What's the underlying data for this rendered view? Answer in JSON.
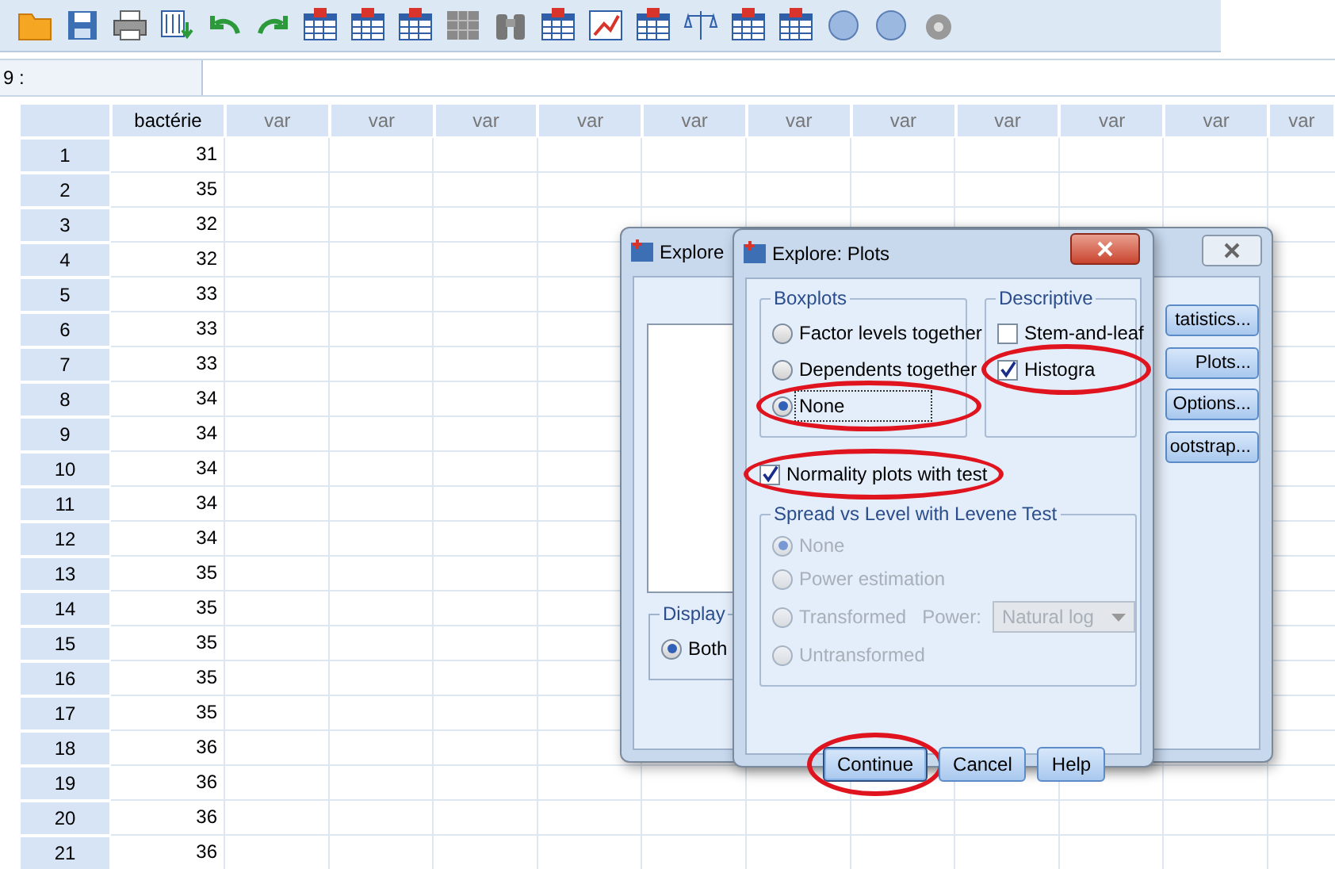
{
  "cell_reference": {
    "label": "9 :"
  },
  "grid": {
    "columns": [
      "bactérie",
      "var",
      "var",
      "var",
      "var",
      "var",
      "var",
      "var",
      "var",
      "var",
      "var",
      "var"
    ],
    "rows": [
      {
        "number": "1",
        "value": "31"
      },
      {
        "number": "2",
        "value": "35"
      },
      {
        "number": "3",
        "value": "32"
      },
      {
        "number": "4",
        "value": "32"
      },
      {
        "number": "5",
        "value": "33"
      },
      {
        "number": "6",
        "value": "33"
      },
      {
        "number": "7",
        "value": "33"
      },
      {
        "number": "8",
        "value": "34"
      },
      {
        "number": "9",
        "value": "34"
      },
      {
        "number": "10",
        "value": "34"
      },
      {
        "number": "11",
        "value": "34"
      },
      {
        "number": "12",
        "value": "34"
      },
      {
        "number": "13",
        "value": "35"
      },
      {
        "number": "14",
        "value": "35"
      },
      {
        "number": "15",
        "value": "35"
      },
      {
        "number": "16",
        "value": "35"
      },
      {
        "number": "17",
        "value": "35"
      },
      {
        "number": "18",
        "value": "36"
      },
      {
        "number": "19",
        "value": "36"
      },
      {
        "number": "20",
        "value": "36"
      },
      {
        "number": "21",
        "value": "36"
      }
    ]
  },
  "explore_dialog": {
    "title": "Explore",
    "buttons": [
      "tatistics...",
      "Plots...",
      "Options...",
      "ootstrap..."
    ],
    "display": {
      "label": "Display",
      "options": [
        {
          "label": "Both",
          "selected": true
        }
      ]
    }
  },
  "plots_dialog": {
    "title": "Explore: Plots",
    "boxplots": {
      "label": "Boxplots",
      "options": [
        {
          "label": "Factor levels together",
          "selected": false,
          "focused": false,
          "circled": false
        },
        {
          "label": "Dependents together",
          "selected": false,
          "focused": false,
          "circled": false
        },
        {
          "label": "None",
          "selected": true,
          "focused": true,
          "circled": true
        }
      ]
    },
    "descriptive": {
      "label": "Descriptive",
      "options": [
        {
          "label": "Stem-and-leaf",
          "checked": false,
          "circled": false
        },
        {
          "label": "Histogra",
          "checked": true,
          "circled": true
        }
      ]
    },
    "normality": {
      "label": "Normality plots with test",
      "checked": true,
      "circled": true
    },
    "spread": {
      "label": "Spread vs Level with Levene Test",
      "disabled": true,
      "options": [
        {
          "label": "None",
          "selected": true
        },
        {
          "label": "Power estimation",
          "selected": false
        },
        {
          "label": "Transformed",
          "selected": false,
          "power_label": "Power:",
          "power_value": "Natural log"
        },
        {
          "label": "Untransformed",
          "selected": false
        }
      ]
    },
    "buttons": [
      {
        "label": "Continue",
        "default": true,
        "circled": true
      },
      {
        "label": "Cancel",
        "default": false,
        "circled": false
      },
      {
        "label": "Help",
        "default": false,
        "circled": false
      }
    ]
  }
}
